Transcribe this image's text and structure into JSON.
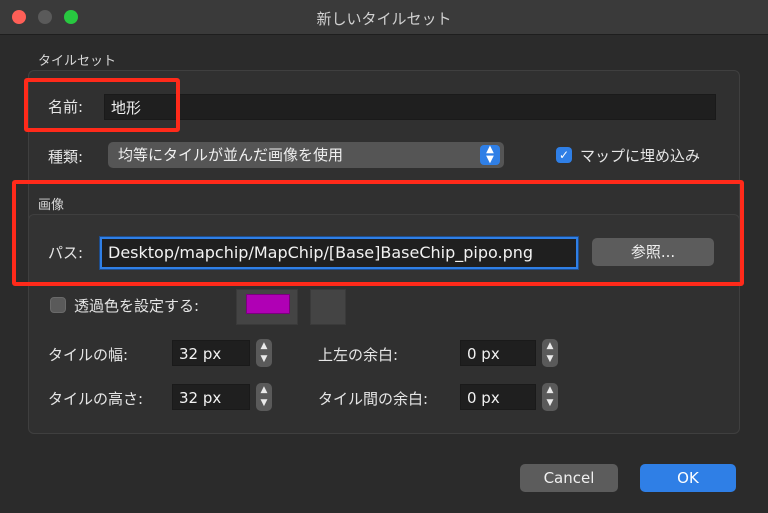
{
  "window": {
    "title": "新しいタイルセット"
  },
  "tileset_section": {
    "label": "タイルセット"
  },
  "name": {
    "label": "名前:",
    "value": "地形"
  },
  "type": {
    "label": "種類:",
    "selected": "均等にタイルが並んだ画像を使用",
    "embed_label": "マップに埋め込み",
    "embed_checked": true
  },
  "image_section": {
    "label": "画像",
    "path_label": "パス:",
    "path_value": "Desktop/mapchip/MapChip/[Base]BaseChip_pipo.png",
    "browse_label": "参照..."
  },
  "transparency": {
    "label": "透過色を設定する:",
    "checked": false,
    "color": "#b000b5"
  },
  "tile_width": {
    "label": "タイルの幅:",
    "value": "32 px"
  },
  "tile_height": {
    "label": "タイルの高さ:",
    "value": "32 px"
  },
  "margin": {
    "label": "上左の余白:",
    "value": "0 px"
  },
  "spacing": {
    "label": "タイル間の余白:",
    "value": "0 px"
  },
  "buttons": {
    "cancel": "Cancel",
    "ok": "OK"
  },
  "annotation_color": "#ff2a1a"
}
